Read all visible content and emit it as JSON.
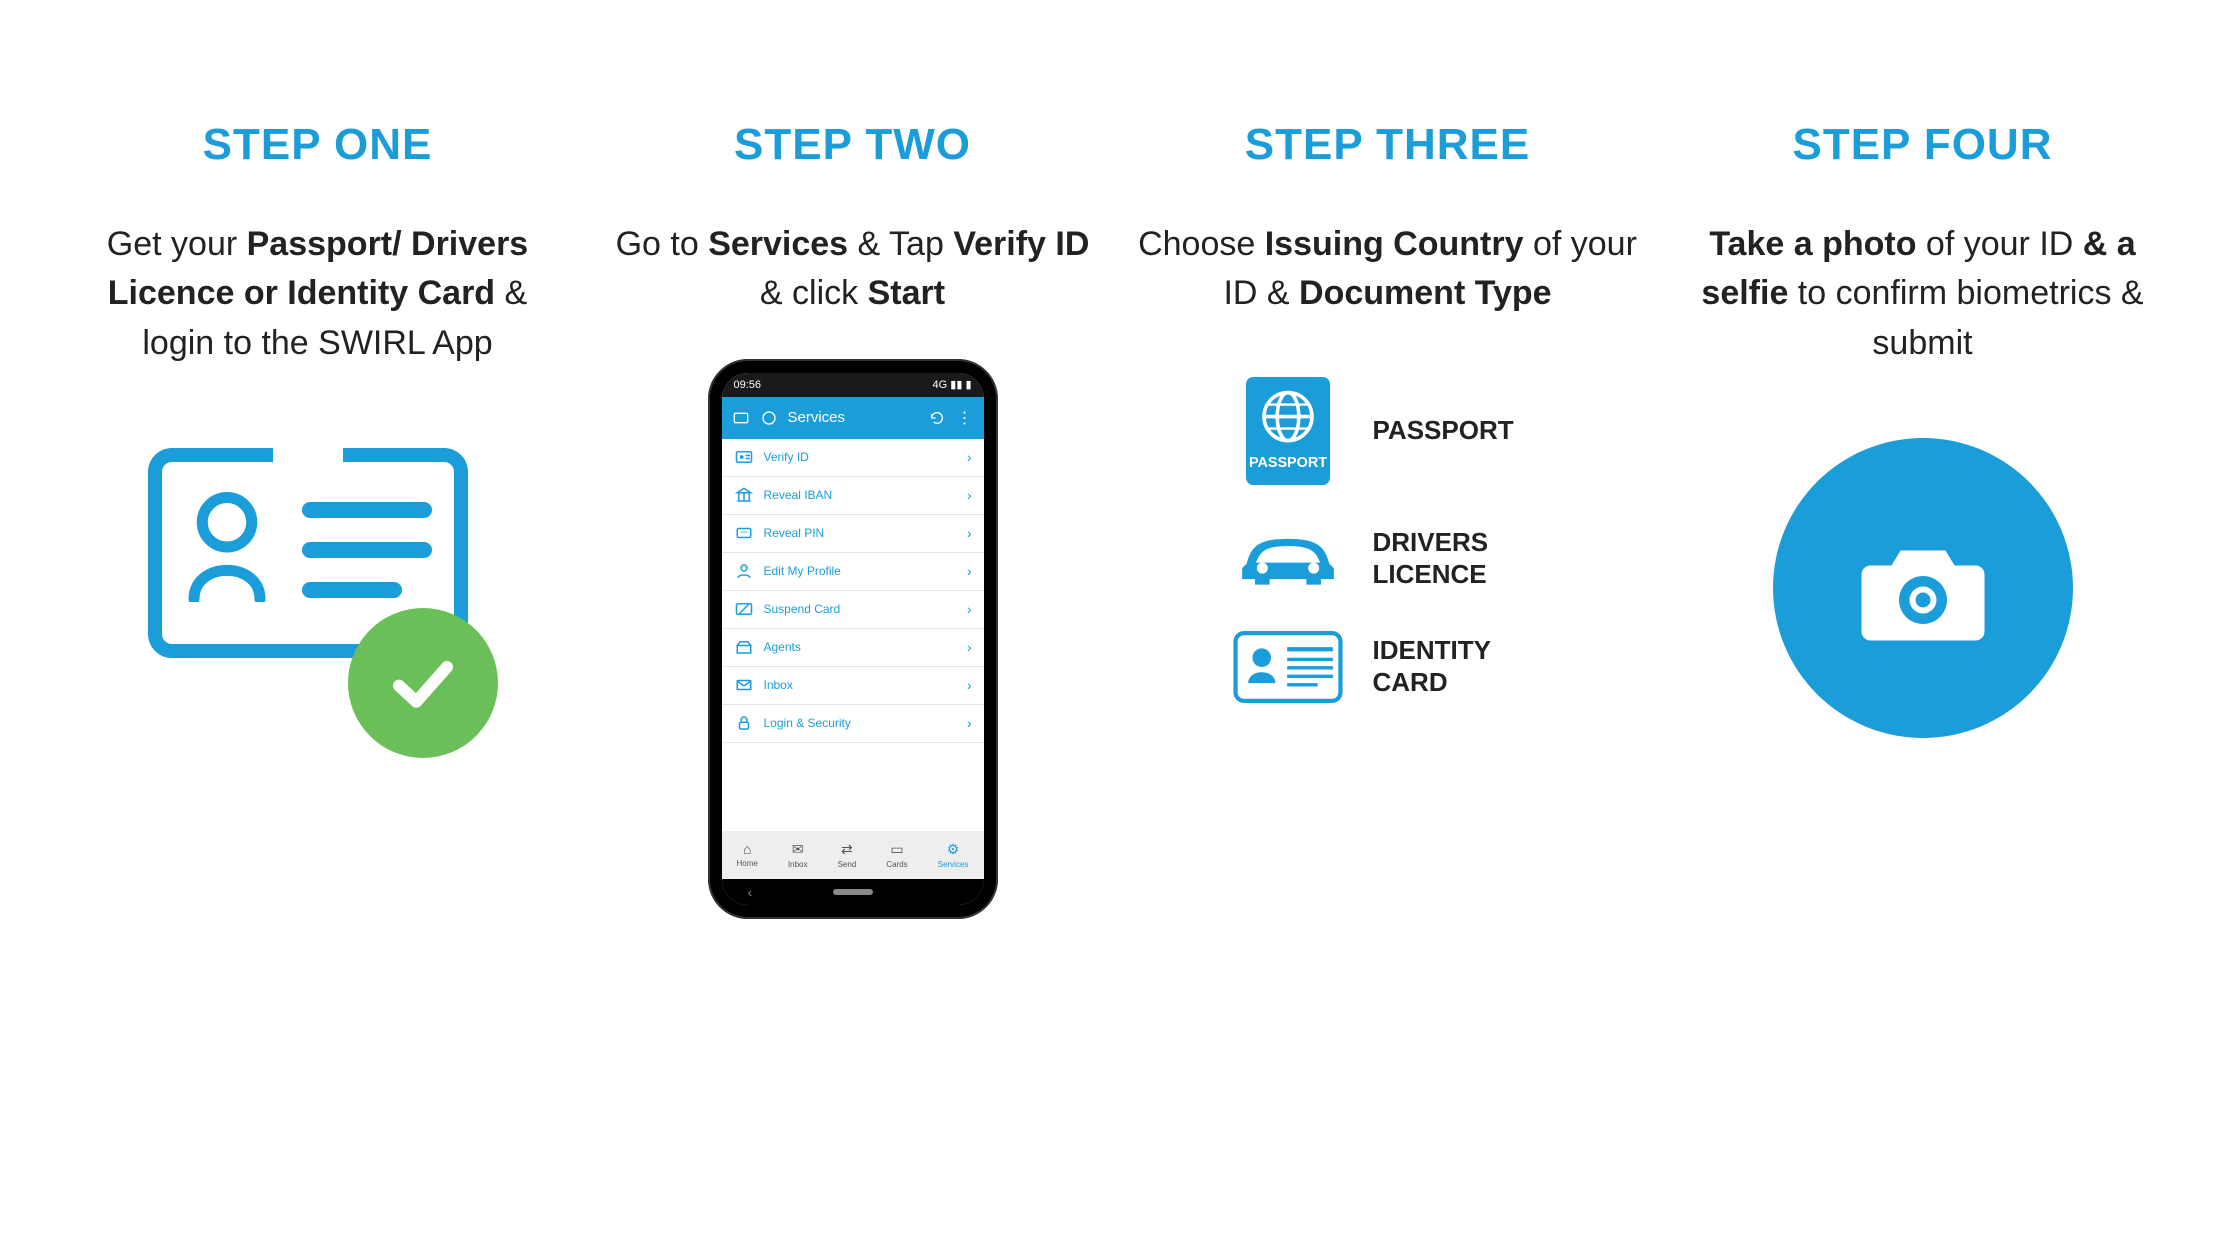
{
  "colors": {
    "accent": "#1b9dd9",
    "success": "#6bbf59",
    "text": "#222222"
  },
  "steps": [
    {
      "title": "STEP ONE",
      "desc_pre": "Get your ",
      "desc_bold1": "Passport/ Drivers Licence or Identity Card",
      "desc_mid": " & login to the SWIRL App",
      "desc_bold2": "",
      "desc_post": ""
    },
    {
      "title": "STEP TWO",
      "desc_pre": "Go to ",
      "desc_bold1": "Services",
      "desc_mid": " & Tap ",
      "desc_bold2": "Verify ID",
      "desc_post": " & click ",
      "desc_bold3": "Start"
    },
    {
      "title": "STEP THREE",
      "desc_pre": "Choose ",
      "desc_bold1": "Issuing Country",
      "desc_mid": " of your ID & ",
      "desc_bold2": "Document Type",
      "desc_post": ""
    },
    {
      "title": "STEP FOUR",
      "desc_pre": "",
      "desc_bold1": "Take a photo",
      "desc_mid": " of your ID ",
      "desc_bold2": "& a selfie",
      "desc_post": " to confirm biometrics & submit"
    }
  ],
  "phone": {
    "status_left": "09:56",
    "status_right": "4G",
    "appbar_title": "Services",
    "services": [
      {
        "icon": "id",
        "label": "Verify ID"
      },
      {
        "icon": "bank",
        "label": "Reveal IBAN"
      },
      {
        "icon": "pin",
        "label": "Reveal PIN"
      },
      {
        "icon": "profile",
        "label": "Edit My Profile"
      },
      {
        "icon": "suspend",
        "label": "Suspend Card"
      },
      {
        "icon": "agents",
        "label": "Agents"
      },
      {
        "icon": "inbox",
        "label": "Inbox"
      },
      {
        "icon": "lock",
        "label": "Login & Security"
      }
    ],
    "bottom": [
      {
        "label": "Home"
      },
      {
        "label": "Inbox"
      },
      {
        "label": "Send"
      },
      {
        "label": "Cards"
      },
      {
        "label": "Services"
      }
    ]
  },
  "documents": [
    {
      "icon": "passport",
      "label": "PASSPORT"
    },
    {
      "icon": "car",
      "label": "DRIVERS LICENCE"
    },
    {
      "icon": "idcard",
      "label": "IDENTITY CARD"
    }
  ]
}
